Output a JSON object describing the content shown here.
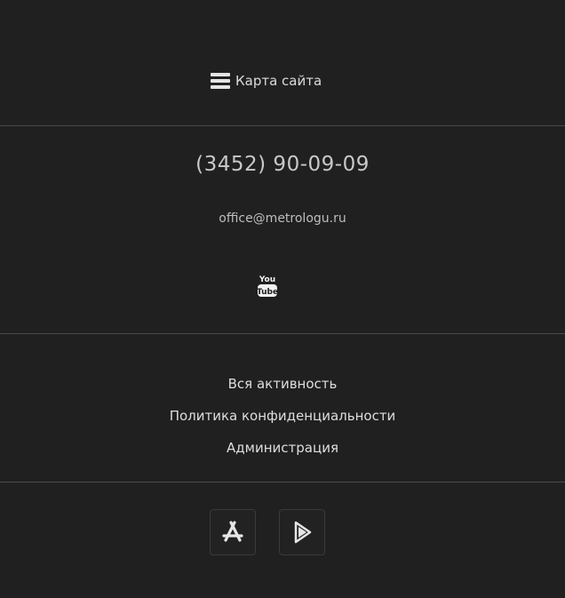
{
  "sitemap": {
    "label": "Карта сайта",
    "icon": "hamburger-icon"
  },
  "contacts": {
    "phone": "(3452) 90-09-09",
    "email": "office@metrologu.ru",
    "youtube": {
      "icon": "youtube-icon",
      "text_top": "You",
      "text_bottom": "Tube"
    }
  },
  "links": [
    {
      "label": "Вся активность"
    },
    {
      "label": "Политика конфиденциальности"
    },
    {
      "label": "Администрация"
    }
  ],
  "apps": [
    {
      "name": "App Store",
      "icon": "app-store-icon"
    },
    {
      "name": "Google Play",
      "icon": "google-play-icon"
    }
  ],
  "colors": {
    "background": "#202020",
    "divider": "#4a4a4a",
    "text": "#dedede"
  }
}
